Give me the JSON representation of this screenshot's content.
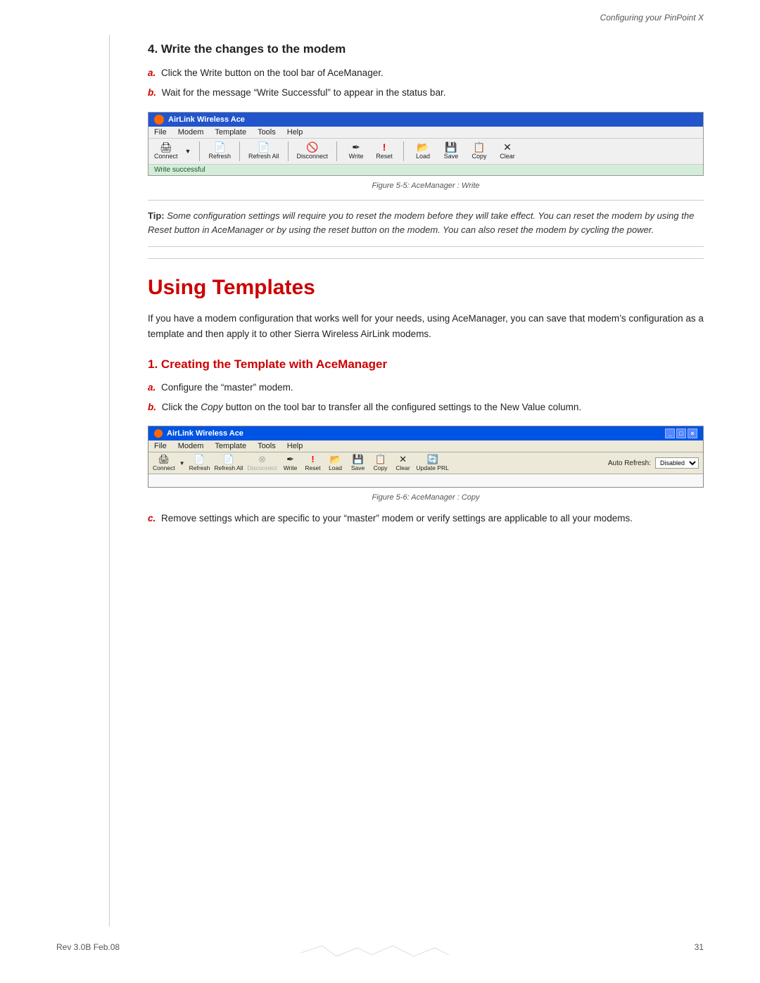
{
  "header": {
    "title": "Configuring your PinPoint X"
  },
  "footer": {
    "rev": "Rev 3.0B  Feb.08",
    "page": "31"
  },
  "section4": {
    "heading": "4. Write the changes to the modem",
    "step_a": "Click the Write button on the tool bar of AceManager.",
    "step_b": "Wait for the message “Write Successful” to appear in the status bar."
  },
  "figure1": {
    "caption": "Figure 5-5:  AceManager : Write"
  },
  "tip": {
    "label": "Tip:",
    "text": " Some configuration settings will require you to reset the modem before they will take effect. You can reset the modem by using the Reset button in AceManager or by using the reset button on the modem. You can also reset the modem by cycling the power."
  },
  "main_section": {
    "heading": "Using Templates",
    "body": "If you have a modem configuration that works well for your needs, using AceManager, you can save that modem’s configuration as a template and then apply it to other Sierra Wireless AirLink modems."
  },
  "section1": {
    "heading": "1. Creating the Template with AceManager",
    "step_a": "Configure the “master” modem.",
    "step_b_prefix": "Click the ",
    "step_b_italic": "Copy",
    "step_b_suffix": " button on the tool bar to transfer all the configured settings to the New Value column."
  },
  "figure2": {
    "caption": "Figure 5-6:  AceManager : Copy"
  },
  "section1c": {
    "step_c": "Remove settings which are specific to your “master” modem or verify settings are applicable to all your modems."
  },
  "toolbar1": {
    "title": "AirLink Wireless Ace",
    "menu_items": [
      "File",
      "Modem",
      "Template",
      "Tools",
      "Help"
    ],
    "buttons": [
      {
        "label": "Connect",
        "icon": "📋"
      },
      {
        "label": "Refresh",
        "icon": "📄"
      },
      {
        "label": "Refresh All",
        "icon": "📄"
      },
      {
        "label": "Disconnect",
        "icon": "⊗"
      },
      {
        "label": "Write",
        "icon": "✏"
      },
      {
        "label": "Reset",
        "icon": "!"
      },
      {
        "label": "Load",
        "icon": "📂"
      },
      {
        "label": "Save",
        "icon": "💾"
      },
      {
        "label": "Copy",
        "icon": "📋"
      },
      {
        "label": "Clear",
        "icon": "✕"
      }
    ],
    "status": "Write successful"
  },
  "toolbar2": {
    "title": "AirLink Wireless Ace",
    "menu_items": [
      "File",
      "Modem",
      "Template",
      "Tools",
      "Help"
    ],
    "buttons": [
      {
        "label": "Connect",
        "icon": "📋"
      },
      {
        "label": "Refresh",
        "icon": "📄"
      },
      {
        "label": "Refresh All",
        "icon": "📄"
      },
      {
        "label": "Disconnect",
        "icon": "⊗",
        "disabled": true
      },
      {
        "label": "Write",
        "icon": "✏"
      },
      {
        "label": "Reset",
        "icon": "!"
      },
      {
        "label": "Load",
        "icon": "📂"
      },
      {
        "label": "Save",
        "icon": "💾"
      },
      {
        "label": "Copy",
        "icon": "📋"
      },
      {
        "label": "Clear",
        "icon": "✕"
      },
      {
        "label": "Update PRL",
        "icon": "🔄"
      }
    ],
    "auto_refresh_label": "Auto Refresh:",
    "auto_refresh_value": "Disabled"
  }
}
